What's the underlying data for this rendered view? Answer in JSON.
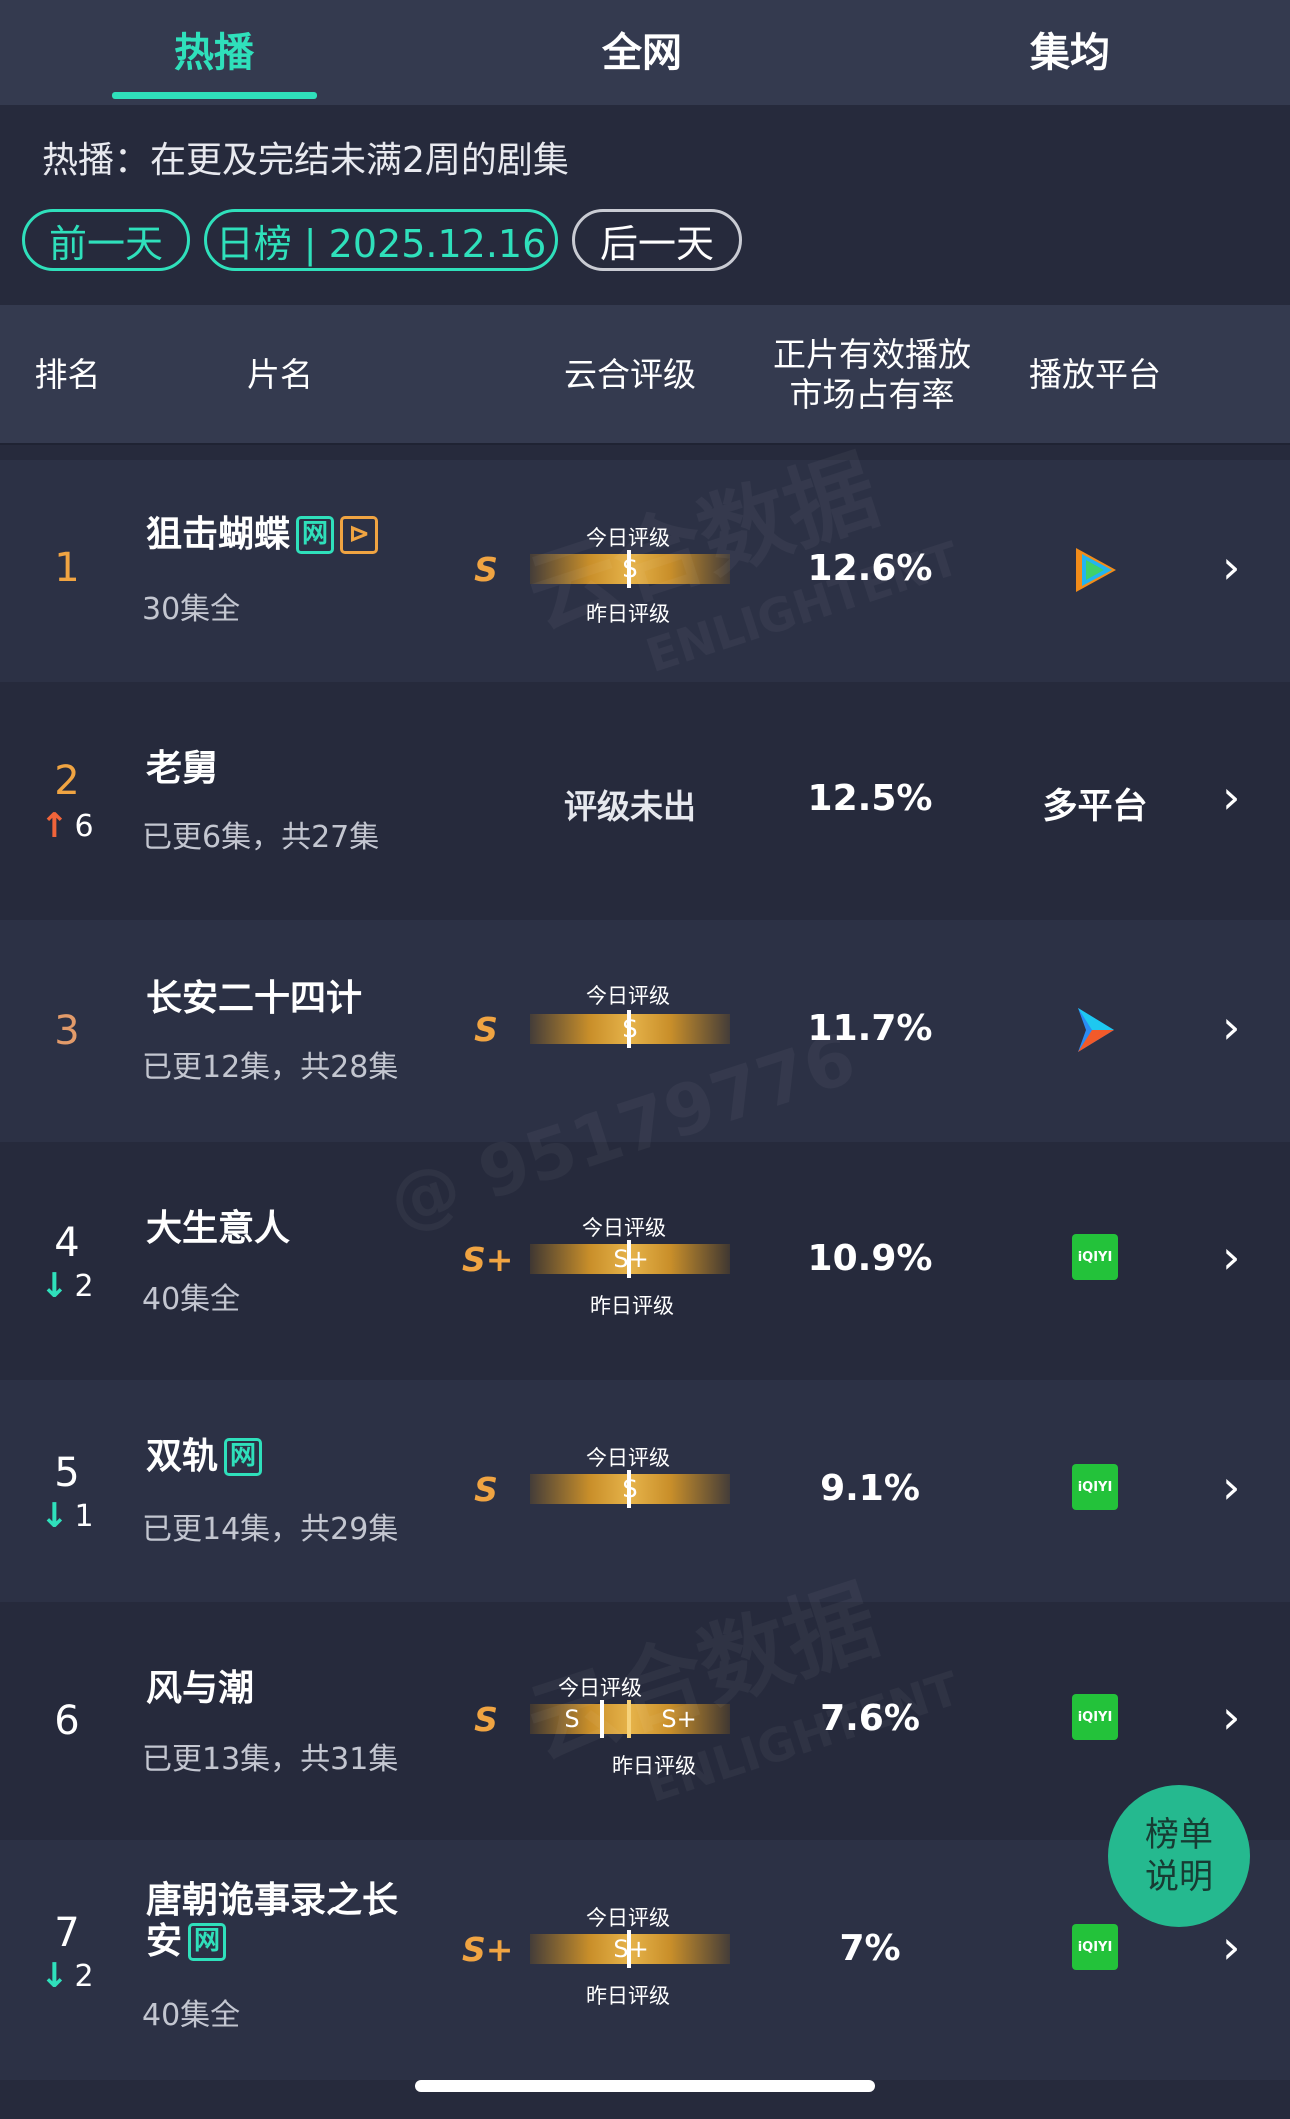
{
  "tabs": [
    "热播",
    "全网",
    "集均"
  ],
  "info": {
    "description": "热播：在更及完结未满2周的剧集",
    "prev_day": "前一天",
    "current": "日榜 | 2025.12.16",
    "next_day": "后一天"
  },
  "table_header": {
    "rank": "排名",
    "name": "片名",
    "rating": "云合评级",
    "share_line1": "正片有效播放",
    "share_line2": "市场占有率",
    "platform": "播放平台"
  },
  "rating_labels": {
    "today": "今日评级",
    "yesterday": "昨日评级"
  },
  "rows": [
    {
      "rank": "1",
      "title": "狙击蝴蝶",
      "badges": [
        "网",
        "⊳"
      ],
      "subtitle": "30集全",
      "grade": "S",
      "bar_today": "S",
      "share": "12.6%",
      "platform": "tencent-video",
      "change": ""
    },
    {
      "rank": "2",
      "change_dir": "up",
      "change": "6",
      "title": "老舅",
      "subtitle": "已更6集，共27集",
      "rating_pending": "评级未出",
      "share": "12.5%",
      "platform_text": "多平台"
    },
    {
      "rank": "3",
      "title": "长安二十四计",
      "subtitle": "已更12集，共28集",
      "grade": "S",
      "bar_today": "S",
      "share": "11.7%",
      "platform": "youku",
      "change": ""
    },
    {
      "rank": "4",
      "change_dir": "down",
      "change": "2",
      "title": "大生意人",
      "subtitle": "40集全",
      "grade": "S+",
      "bar_today": "S+",
      "share": "10.9%",
      "platform": "iqiyi"
    },
    {
      "rank": "5",
      "change_dir": "down",
      "change": "1",
      "title": "双轨",
      "badges": [
        "网"
      ],
      "subtitle": "已更14集，共29集",
      "grade": "S",
      "bar_today": "S",
      "share": "9.1%",
      "platform": "iqiyi"
    },
    {
      "rank": "6",
      "title": "风与潮",
      "subtitle": "已更13集，共31集",
      "grade": "S",
      "bar_today": "S",
      "bar_yesterday": "S+",
      "share": "7.6%",
      "platform": "iqiyi",
      "change": ""
    },
    {
      "rank": "7",
      "change_dir": "down",
      "change": "2",
      "title_line1": "唐朝诡事录之长",
      "title_line2": "安",
      "badges": [
        "网"
      ],
      "subtitle": "40集全",
      "grade": "S+",
      "bar_today": "S+",
      "share": "7%",
      "platform": "iqiyi"
    }
  ],
  "iqiyi_label": "iQIYI",
  "float_button": {
    "line1": "榜单",
    "line2": "说明"
  },
  "watermark": {
    "brand": "云合数据",
    "brand_en": "ENLIGHTENT",
    "id": "@ 95179776"
  },
  "colors": {
    "accent": "#2fe0bb",
    "gold": "#f0a442",
    "up": "#f0643a",
    "down": "#2fe0bb"
  }
}
